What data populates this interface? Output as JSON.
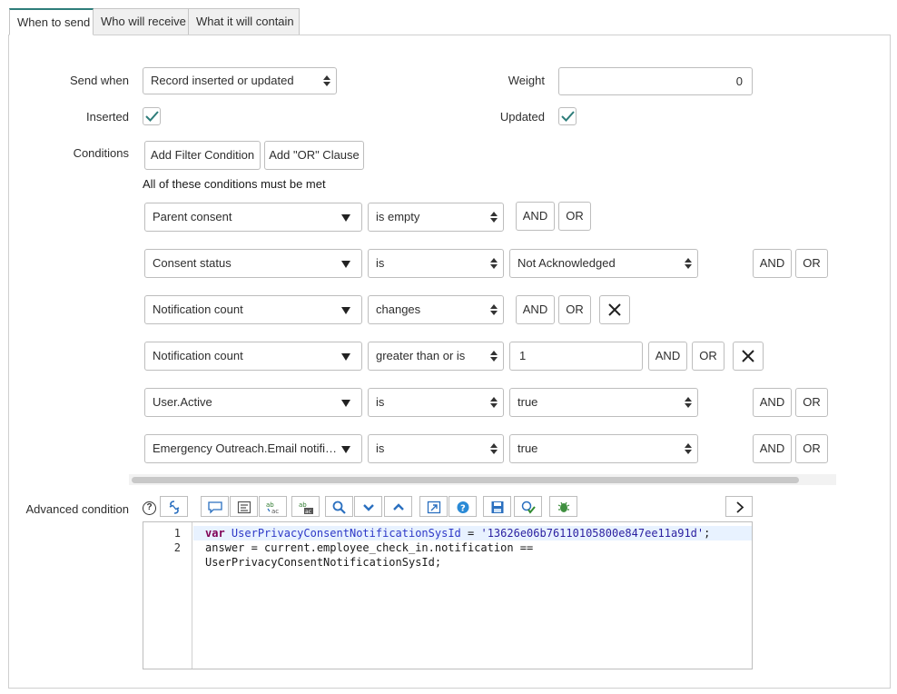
{
  "tabs": [
    {
      "label": "When to send",
      "active": true
    },
    {
      "label": "Who will receive",
      "active": false
    },
    {
      "label": "What it will contain",
      "active": false
    }
  ],
  "form": {
    "send_when_label": "Send when",
    "send_when_value": "Record inserted or updated",
    "weight_label": "Weight",
    "weight_value": "0",
    "inserted_label": "Inserted",
    "inserted_checked": true,
    "updated_label": "Updated",
    "updated_checked": true,
    "conditions_label": "Conditions",
    "add_filter_label": "Add Filter Condition",
    "add_or_label": "Add \"OR\" Clause",
    "all_conditions_text": "All of these conditions must be met"
  },
  "conditions": [
    {
      "field": "Parent consent",
      "operator": "is empty",
      "value": "",
      "and": "AND",
      "or": "OR"
    },
    {
      "field": "Consent status",
      "operator": "is",
      "value": "Not Acknowledged",
      "and": "AND",
      "or": "OR"
    },
    {
      "field": "Notification count",
      "operator": "changes",
      "value": "",
      "and": "AND",
      "or": "OR"
    },
    {
      "field": "Notification count",
      "operator": "greater than or is",
      "value": "1",
      "and": "AND",
      "or": "OR"
    },
    {
      "field": "User.Active",
      "operator": "is",
      "value": "true",
      "and": "AND",
      "or": "OR"
    },
    {
      "field": "Emergency Outreach.Email notifica…",
      "operator": "is",
      "value": "true",
      "and": "AND",
      "or": "OR"
    }
  ],
  "advanced": {
    "label": "Advanced condition",
    "toolbar_icons": [
      "help-icon",
      "script-include-icon",
      "comment-icon",
      "format-code-icon",
      "replace-icon",
      "replace-all-icon",
      "search-icon",
      "find-next-icon",
      "find-previous-icon",
      "fullscreen-icon",
      "help-circle-icon",
      "save-icon",
      "validate-icon",
      "debug-icon",
      "expand-arrow-icon"
    ],
    "code": {
      "line1_num": "1",
      "line2_num": "2",
      "line1_kw": "var",
      "line1_var": "UserPrivacyConsentNotificationSysId",
      "line1_eq": " = ",
      "line1_str": "'13626e06b76110105800e847ee11a91d'",
      "line1_end": ";",
      "line2a": "answer = current.employee_check_in.notification ==",
      "line2b": "UserPrivacyConsentNotificationSysId;"
    }
  },
  "colors": {
    "accent": "#2e7d7a",
    "check": "#2e7d7a",
    "keyword": "#7f0055",
    "variable": "#2d38c7",
    "string": "#2a1fa0"
  }
}
